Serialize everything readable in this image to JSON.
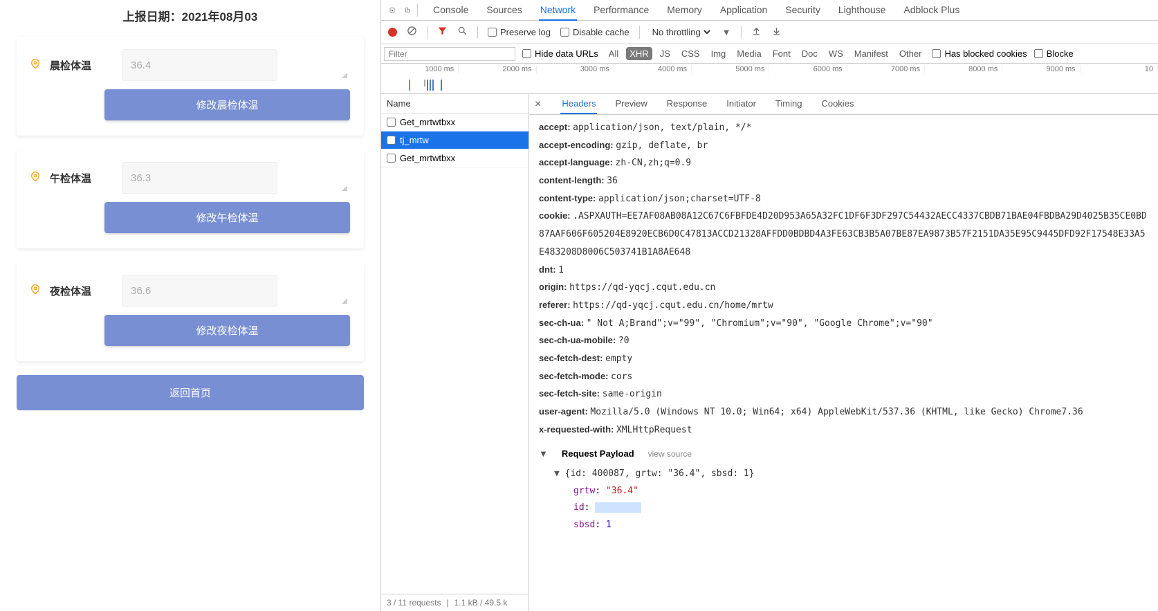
{
  "left": {
    "report_date": "上报日期：2021年08月03",
    "cards": [
      {
        "label": "晨检体温",
        "value": "36.4",
        "button": "修改晨检体温"
      },
      {
        "label": "午检体温",
        "value": "36.3",
        "button": "修改午检体温"
      },
      {
        "label": "夜检体温",
        "value": "36.6",
        "button": "修改夜检体温"
      }
    ],
    "home_button": "返回首页"
  },
  "devtools": {
    "tabs": [
      "Console",
      "Sources",
      "Network",
      "Performance",
      "Memory",
      "Application",
      "Security",
      "Lighthouse",
      "Adblock Plus"
    ],
    "active_tab": "Network",
    "toolbar": {
      "preserve_log": "Preserve log",
      "disable_cache": "Disable cache",
      "throttling": "No throttling"
    },
    "filterbar": {
      "filter_placeholder": "Filter",
      "hide_data_urls": "Hide data URLs",
      "chips": [
        "All",
        "XHR",
        "JS",
        "CSS",
        "Img",
        "Media",
        "Font",
        "Doc",
        "WS",
        "Manifest",
        "Other"
      ],
      "active_chip": "XHR",
      "has_blocked": "Has blocked cookies",
      "blocked": "Blocke"
    },
    "timeline_ticks": [
      "1000 ms",
      "2000 ms",
      "3000 ms",
      "4000 ms",
      "5000 ms",
      "6000 ms",
      "7000 ms",
      "8000 ms",
      "9000 ms",
      "10"
    ],
    "request_list": {
      "header": "Name",
      "items": [
        "Get_mrtwtbxx",
        "tj_mrtw",
        "Get_mrtwtbxx"
      ],
      "selected_index": 1,
      "status": "3 / 11 requests",
      "transfer": "1.1 kB / 49.5 k"
    },
    "detail_tabs": [
      "Headers",
      "Preview",
      "Response",
      "Initiator",
      "Timing",
      "Cookies"
    ],
    "active_detail_tab": "Headers",
    "headers": [
      {
        "k": "accept",
        "v": "application/json, text/plain, */*"
      },
      {
        "k": "accept-encoding",
        "v": "gzip, deflate, br"
      },
      {
        "k": "accept-language",
        "v": "zh-CN,zh;q=0.9"
      },
      {
        "k": "content-length",
        "v": "36"
      },
      {
        "k": "content-type",
        "v": "application/json;charset=UTF-8"
      },
      {
        "k": "cookie",
        "v": ".ASPXAUTH=EE7AF08AB08A12C67C6FBFDE4D20D953A65A32FC1DF6F3DF297C54432AECC4337CBDB71BAE04FBDBA29D4025B35CE0BD87AAF606F605204E8920ECB6D0C47813ACCD21328AFFDD0BDBD4A3FE63CB3B5A07BE87EA9873B57F2151DA35E95C9445DFD92F17548E33A5E483208D8006C503741B1A8AE648"
      },
      {
        "k": "dnt",
        "v": "1"
      },
      {
        "k": "origin",
        "v": "https://qd-yqcj.cqut.edu.cn"
      },
      {
        "k": "referer",
        "v": "https://qd-yqcj.cqut.edu.cn/home/mrtw"
      },
      {
        "k": "sec-ch-ua",
        "v": "\" Not A;Brand\";v=\"99\", \"Chromium\";v=\"90\", \"Google Chrome\";v=\"90\""
      },
      {
        "k": "sec-ch-ua-mobile",
        "v": "?0"
      },
      {
        "k": "sec-fetch-dest",
        "v": "empty"
      },
      {
        "k": "sec-fetch-mode",
        "v": "cors"
      },
      {
        "k": "sec-fetch-site",
        "v": "same-origin"
      },
      {
        "k": "user-agent",
        "v": "Mozilla/5.0 (Windows NT 10.0; Win64; x64) AppleWebKit/537.36 (KHTML, like Gecko) Chrome7.36"
      },
      {
        "k": "x-requested-with",
        "v": "XMLHttpRequest"
      }
    ],
    "payload": {
      "section_title": "Request Payload",
      "view_source": "view source",
      "summary": "{id: 400087, grtw: \"36.4\", sbsd: 1}",
      "fields": [
        {
          "key": "grtw",
          "type": "str",
          "val": "\"36.4\""
        },
        {
          "key": "id",
          "type": "redacted",
          "val": ""
        },
        {
          "key": "sbsd",
          "type": "num",
          "val": "1"
        }
      ]
    }
  }
}
